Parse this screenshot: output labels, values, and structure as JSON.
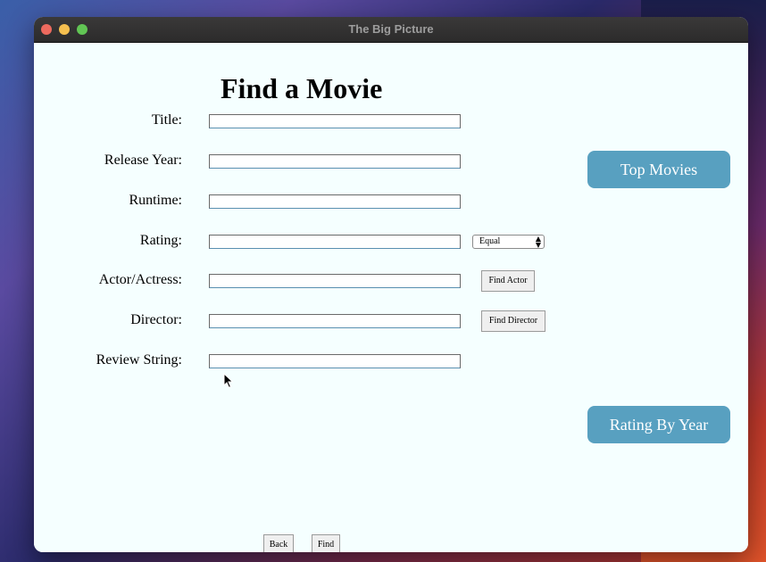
{
  "window": {
    "title": "The Big Picture"
  },
  "page": {
    "heading": "Find a Movie"
  },
  "form": {
    "title_label": "Title:",
    "release_year_label": "Release Year:",
    "runtime_label": "Runtime:",
    "rating_label": "Rating:",
    "actor_label": "Actor/Actress:",
    "director_label": "Director:",
    "review_label": "Review String:",
    "title_value": "",
    "release_year_value": "",
    "runtime_value": "",
    "rating_value": "",
    "actor_value": "",
    "director_value": "",
    "review_value": "",
    "rating_comparator": "Equal"
  },
  "buttons": {
    "find_actor": "Find Actor",
    "find_director": "Find Director",
    "top_movies": "Top Movies",
    "rating_by_year": "Rating By Year",
    "back": "Back",
    "find": "Find"
  },
  "colors": {
    "accent": "#58a0c0",
    "background": "#f5ffff"
  }
}
